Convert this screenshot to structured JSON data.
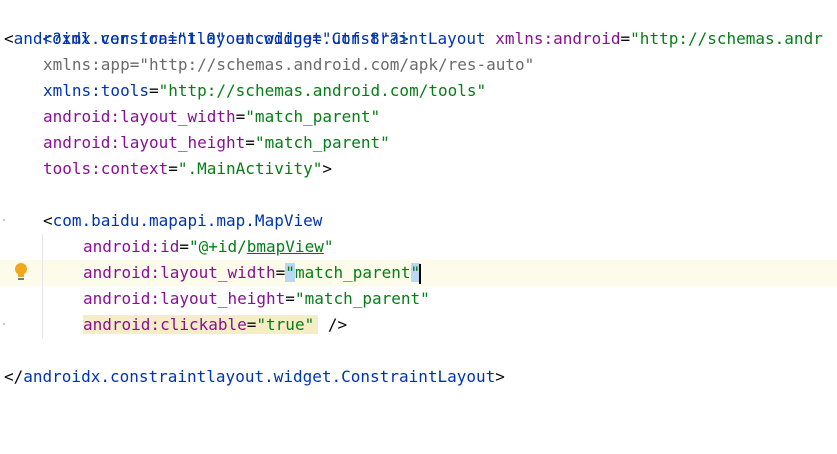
{
  "editor": {
    "line1": {
      "decl": "<?xml version=\"1.0\" encoding=\"utf-8\"?>"
    },
    "line2": {
      "open": "<",
      "tag": "androidx.constraintlayout.widget.ConstraintLayout",
      "attr": "xmlns:android",
      "eq": "=",
      "value": "\"http://schemas.andr"
    },
    "line3": {
      "attr": "xmlns:app",
      "eq": "=",
      "value": "\"http://schemas.android.com/apk/res-auto\""
    },
    "line4": {
      "attr": "xmlns:tools",
      "eq": "=",
      "value": "\"http://schemas.android.com/tools\""
    },
    "line5": {
      "attr": "android:layout_width",
      "eq": "=",
      "value": "\"match_parent\""
    },
    "line6": {
      "attr": "android:layout_height",
      "eq": "=",
      "value": "\"match_parent\""
    },
    "line7": {
      "attr": "tools:context",
      "eq": "=",
      "value": "\".MainActivity\"",
      "close": ">"
    },
    "line9": {
      "open": "<",
      "tag": "com.baidu.mapapi.map.MapView"
    },
    "line10": {
      "attr": "android:id",
      "eq": "=",
      "value_pre": "\"@+id/",
      "value_id": "bmapView",
      "value_post": "\""
    },
    "line11": {
      "attr": "android:layout_width",
      "eq": "=",
      "quote_open": "\"",
      "value": "match_parent",
      "quote_close": "\""
    },
    "line12": {
      "attr": "android:layout_height",
      "eq": "=",
      "value": "\"match_parent\""
    },
    "line13": {
      "attr": "android:clickable",
      "eq": "=",
      "value": "\"true\"",
      "close": " />"
    },
    "line15": {
      "open": "</",
      "tag": "androidx.constraintlayout.widget.ConstraintLayout",
      "close": ">"
    }
  },
  "gutter": {
    "intention_icon": "lightbulb-icon"
  },
  "colors": {
    "tag": "#0033b3",
    "attribute": "#871094",
    "namespace_dim": "#6b6b6b",
    "value": "#067d17",
    "text": "#080808",
    "current_line": "#fdfbea",
    "selection": "#b8d7f2",
    "warning_highlight": "#f5edc6",
    "bulb": "#f0a81e"
  }
}
